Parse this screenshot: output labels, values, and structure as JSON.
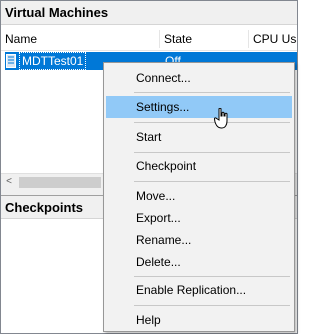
{
  "virtual_machines": {
    "title": "Virtual Machines",
    "columns": [
      "Name",
      "State",
      "CPU Usa"
    ],
    "rows": [
      {
        "name": "MDTTest01",
        "state": "Off"
      }
    ]
  },
  "checkpoints": {
    "title": "Checkpoints"
  },
  "scrollbar": {
    "left_arrow": "<"
  },
  "context_menu": {
    "items": [
      {
        "label": "Connect..."
      },
      {
        "label": "Settings...",
        "hovered": true
      },
      {
        "label": "Start"
      },
      {
        "label": "Checkpoint"
      },
      {
        "label": "Move..."
      },
      {
        "label": "Export..."
      },
      {
        "label": "Rename..."
      },
      {
        "label": "Delete..."
      },
      {
        "label": "Enable Replication..."
      },
      {
        "label": "Help"
      }
    ]
  },
  "colors": {
    "selection": "#0078d7",
    "menu_hover": "#91c9f7",
    "menu_background": "#f2f2f2"
  },
  "icons": {
    "vm": "virtual-machine-icon",
    "cursor": "mouse-pointer-icon"
  }
}
